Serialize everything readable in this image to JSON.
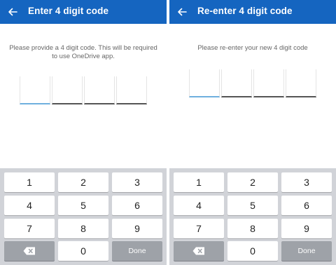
{
  "colors": {
    "appbar": "#1565c0",
    "accent": "#6fb0de",
    "keyboard_bg": "#d1d3d8",
    "key_dark": "#9ea2a8"
  },
  "left": {
    "title": "Enter 4 digit code",
    "message": "Please provide a 4 digit code. This will be required to use OneDrive app.",
    "keys": {
      "k1": "1",
      "k2": "2",
      "k3": "3",
      "k4": "4",
      "k5": "5",
      "k6": "6",
      "k7": "7",
      "k8": "8",
      "k9": "9",
      "k0": "0",
      "done": "Done"
    },
    "backspace_icon": "backspace-icon"
  },
  "right": {
    "title": "Re-enter 4 digit code",
    "message": "Please re-enter your new 4 digit code",
    "keys": {
      "k1": "1",
      "k2": "2",
      "k3": "3",
      "k4": "4",
      "k5": "5",
      "k6": "6",
      "k7": "7",
      "k8": "8",
      "k9": "9",
      "k0": "0",
      "done": "Done"
    },
    "backspace_icon": "backspace-icon"
  }
}
